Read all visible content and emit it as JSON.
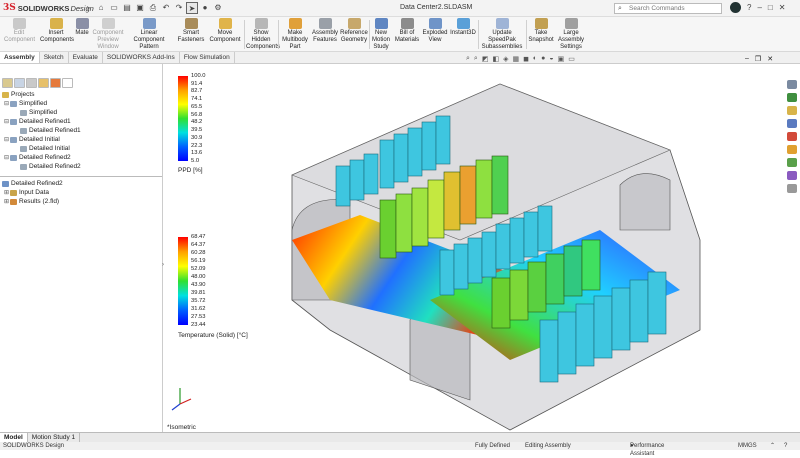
{
  "app": {
    "brand": "SOLIDWORKS",
    "brand_suffix": "Design",
    "logo_mark": "3S",
    "document_title": "Data Center2.SLDASM"
  },
  "search": {
    "placeholder": "Search Commands"
  },
  "ribbon": {
    "buttons": [
      {
        "label": "Edit Component",
        "disabled": true
      },
      {
        "label": "Insert Components"
      },
      {
        "label": "Mate"
      },
      {
        "label": "Component Preview Window",
        "disabled": true
      },
      {
        "label": "Linear Component Pattern"
      },
      {
        "label": "Smart Fasteners"
      },
      {
        "label": "Move Component"
      },
      {
        "label": "Show Hidden Components"
      },
      {
        "label": "Make Multibody Part"
      },
      {
        "label": "Assembly Features"
      },
      {
        "label": "Reference Geometry"
      },
      {
        "label": "New Motion Study"
      },
      {
        "label": "Bill of Materials"
      },
      {
        "label": "Exploded View"
      },
      {
        "label": "Instant3D"
      },
      {
        "label": "Update SpeedPak Subassemblies"
      },
      {
        "label": "Take Snapshot"
      },
      {
        "label": "Large Assembly Settings"
      }
    ]
  },
  "command_tabs": [
    "Assembly",
    "Sketch",
    "Evaluate",
    "SOLIDWORKS Add-Ins",
    "Flow Simulation"
  ],
  "tree": {
    "projects": "Projects",
    "items": [
      {
        "label": "Simplified",
        "level": 1
      },
      {
        "label": "Simplified",
        "level": 2
      },
      {
        "label": "Detailed Refined1",
        "level": 1
      },
      {
        "label": "Detailed Refined1",
        "level": 2
      },
      {
        "label": "Detailed Initial",
        "level": 1
      },
      {
        "label": "Detailed Initial",
        "level": 2
      },
      {
        "label": "Detailed Refined2",
        "level": 1
      },
      {
        "label": "Detailed Refined2",
        "level": 2
      }
    ],
    "active_project": "Detailed Refined2",
    "sub_items": [
      "Input Data",
      "Results (2.fld)"
    ]
  },
  "legend_ppd": {
    "title": "PPD [%]",
    "ticks": [
      "100.0",
      "91.4",
      "82.7",
      "74.1",
      "65.5",
      "56.8",
      "48.2",
      "39.5",
      "30.9",
      "22.3",
      "13.6",
      "5.0"
    ]
  },
  "legend_temp": {
    "title": "Temperature (Solid) [°C]",
    "ticks": [
      "68.47",
      "64.37",
      "60.28",
      "56.19",
      "52.09",
      "48.00",
      "43.90",
      "39.81",
      "35.72",
      "31.62",
      "27.53",
      "23.44"
    ]
  },
  "view_label": "*Isometric",
  "bottom_tabs": [
    "Model",
    "Motion Study 1"
  ],
  "status": {
    "left": "SOLIDWORKS Design",
    "fully_defined": "Fully Defined",
    "editing": "Editing Assembly",
    "assistant": "Performance Assistant",
    "units": "MMGS"
  },
  "colors": {
    "accent_red": "#d6202a",
    "legend_hot": "#ff0000",
    "legend_cold": "#0000ff"
  }
}
